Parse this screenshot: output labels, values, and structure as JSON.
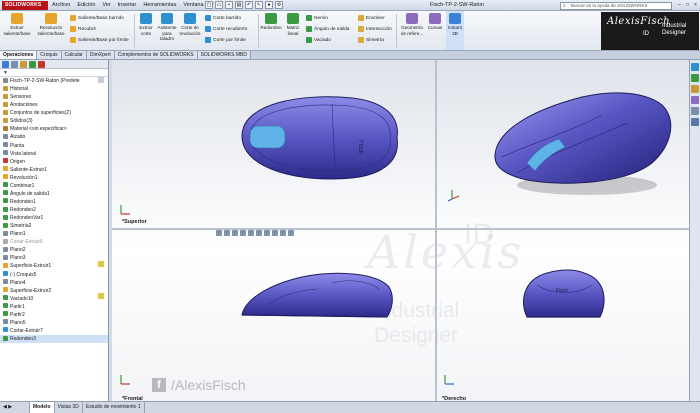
{
  "app": {
    "logo": "SOLIDWORKS",
    "title": "Fisch-TP-2-SW-Raton",
    "search_placeholder": "Buscar en la ayuda de SOLIDWORKS"
  },
  "menu": [
    "Archivo",
    "Edición",
    "Ver",
    "Insertar",
    "Herramientas",
    "Ventana",
    "?"
  ],
  "ribbon": {
    "big": [
      {
        "label": "Extruir saliente/base",
        "color": "#e6a52a"
      },
      {
        "label": "Revolución saliente/base",
        "color": "#e6a52a"
      },
      {
        "label": "Extruir corte",
        "color": "#2e8fd1"
      },
      {
        "label": "Asistente para taladro",
        "color": "#2e8fd1"
      },
      {
        "label": "Corte de revolución",
        "color": "#2e8fd1"
      },
      {
        "label": "Redondeo",
        "color": "#3a9a44"
      },
      {
        "label": "Matriz lineal",
        "color": "#3a9a44"
      },
      {
        "label": "Geometría de refere...",
        "color": "#8c6bbf"
      },
      {
        "label": "Curvas",
        "color": "#8c6bbf"
      },
      {
        "label": "Instant 3D",
        "color": "#3b7fd6"
      }
    ],
    "col1": [
      "Saliente/Base barrido",
      "Recubrir",
      "Saliente/Base por límite"
    ],
    "col2": [
      "Corte barrido",
      "Corte recubierto",
      "Corte por límite"
    ],
    "col3": [
      "Nervio",
      "Ángulo de salida",
      "Vaciado"
    ],
    "col4": [
      "Envolver",
      "Intersección",
      "Simetría"
    ]
  },
  "brand": {
    "mark": "AlexisFisch",
    "id": "ID",
    "sub1": "Industrial",
    "sub2": "Designer"
  },
  "tabs": [
    "Operaciones",
    "Croquis",
    "Calcular",
    "DimXpert",
    "Complementos de SOLIDWORKS",
    "SOLIDWORKS MBD"
  ],
  "tree": [
    {
      "label": "Fisch-TP-2-SW-Raton  (Predete",
      "color": "#888",
      "state": "normal"
    },
    {
      "label": "Historial",
      "color": "#c79a3a",
      "state": "normal"
    },
    {
      "label": "Sensores",
      "color": "#c79a3a",
      "state": "normal"
    },
    {
      "label": "Anotaciones",
      "color": "#c79a3a",
      "state": "normal"
    },
    {
      "label": "Conjuntos de superficies(2)",
      "color": "#c79a3a",
      "state": "normal"
    },
    {
      "label": "Sólidos(3)",
      "color": "#c79a3a",
      "state": "normal"
    },
    {
      "label": "Material <sin especificar>",
      "color": "#b07a2f",
      "state": "normal"
    },
    {
      "label": "Alzado",
      "color": "#7a8aa0",
      "state": "normal"
    },
    {
      "label": "Planta",
      "color": "#7a8aa0",
      "state": "normal"
    },
    {
      "label": "Vista lateral",
      "color": "#7a8aa0",
      "state": "normal"
    },
    {
      "label": "Origen",
      "color": "#cc3333",
      "state": "normal"
    },
    {
      "label": "Saliente-Extruir1",
      "color": "#e6a52a",
      "state": "normal"
    },
    {
      "label": "Revolución1",
      "color": "#e6a52a",
      "state": "normal"
    },
    {
      "label": "Combinar1",
      "color": "#3a9a44",
      "state": "normal"
    },
    {
      "label": "Ángulo de salida1",
      "color": "#3a9a44",
      "state": "normal"
    },
    {
      "label": "Redondeo1",
      "color": "#3a9a44",
      "state": "normal"
    },
    {
      "label": "Redondeo2",
      "color": "#3a9a44",
      "state": "normal"
    },
    {
      "label": "RedondeoVar1",
      "color": "#3a9a44",
      "state": "normal"
    },
    {
      "label": "Simetría2",
      "color": "#3a9a44",
      "state": "normal"
    },
    {
      "label": "Plano1",
      "color": "#7a8aa0",
      "state": "normal"
    },
    {
      "label": "Cortar-Extruir6",
      "color": "#aaaaaa",
      "state": "gray"
    },
    {
      "label": "Plano2",
      "color": "#7a8aa0",
      "state": "normal"
    },
    {
      "label": "Plano3",
      "color": "#7a8aa0",
      "state": "normal"
    },
    {
      "label": "Superficie-Extruir1",
      "color": "#e6a52a",
      "state": "normal"
    },
    {
      "label": "(-) Croquis5",
      "color": "#2e8fd1",
      "state": "normal"
    },
    {
      "label": "Plano4",
      "color": "#7a8aa0",
      "state": "normal"
    },
    {
      "label": "Superficie-Extruir2",
      "color": "#e6a52a",
      "state": "normal"
    },
    {
      "label": "Vaciado10",
      "color": "#3a9a44",
      "state": "normal"
    },
    {
      "label": "Partir1",
      "color": "#3a9a44",
      "state": "normal"
    },
    {
      "label": "Partir2",
      "color": "#3a9a44",
      "state": "normal"
    },
    {
      "label": "Plano5",
      "color": "#7a8aa0",
      "state": "normal"
    },
    {
      "label": "Cortar-Extruir7",
      "color": "#2e8fd1",
      "state": "normal"
    },
    {
      "label": "Redondeo3",
      "color": "#3a9a44",
      "state": "selected"
    }
  ],
  "views": {
    "top": "*Superior",
    "front": "*Frontal",
    "right": "*Derecho"
  },
  "model_text": "Fisch",
  "watermark": {
    "social": "/AlexisFisch",
    "fb": "f"
  },
  "bottom_tabs": [
    "Modelo",
    "Vistas 3D",
    "Estudio de movimiento 1"
  ],
  "colors": {
    "body": "#5a57c4",
    "accent_blue": "#2e8fd1",
    "brand_bg": "#1a1a1a",
    "logo_red": "#b7121a"
  }
}
